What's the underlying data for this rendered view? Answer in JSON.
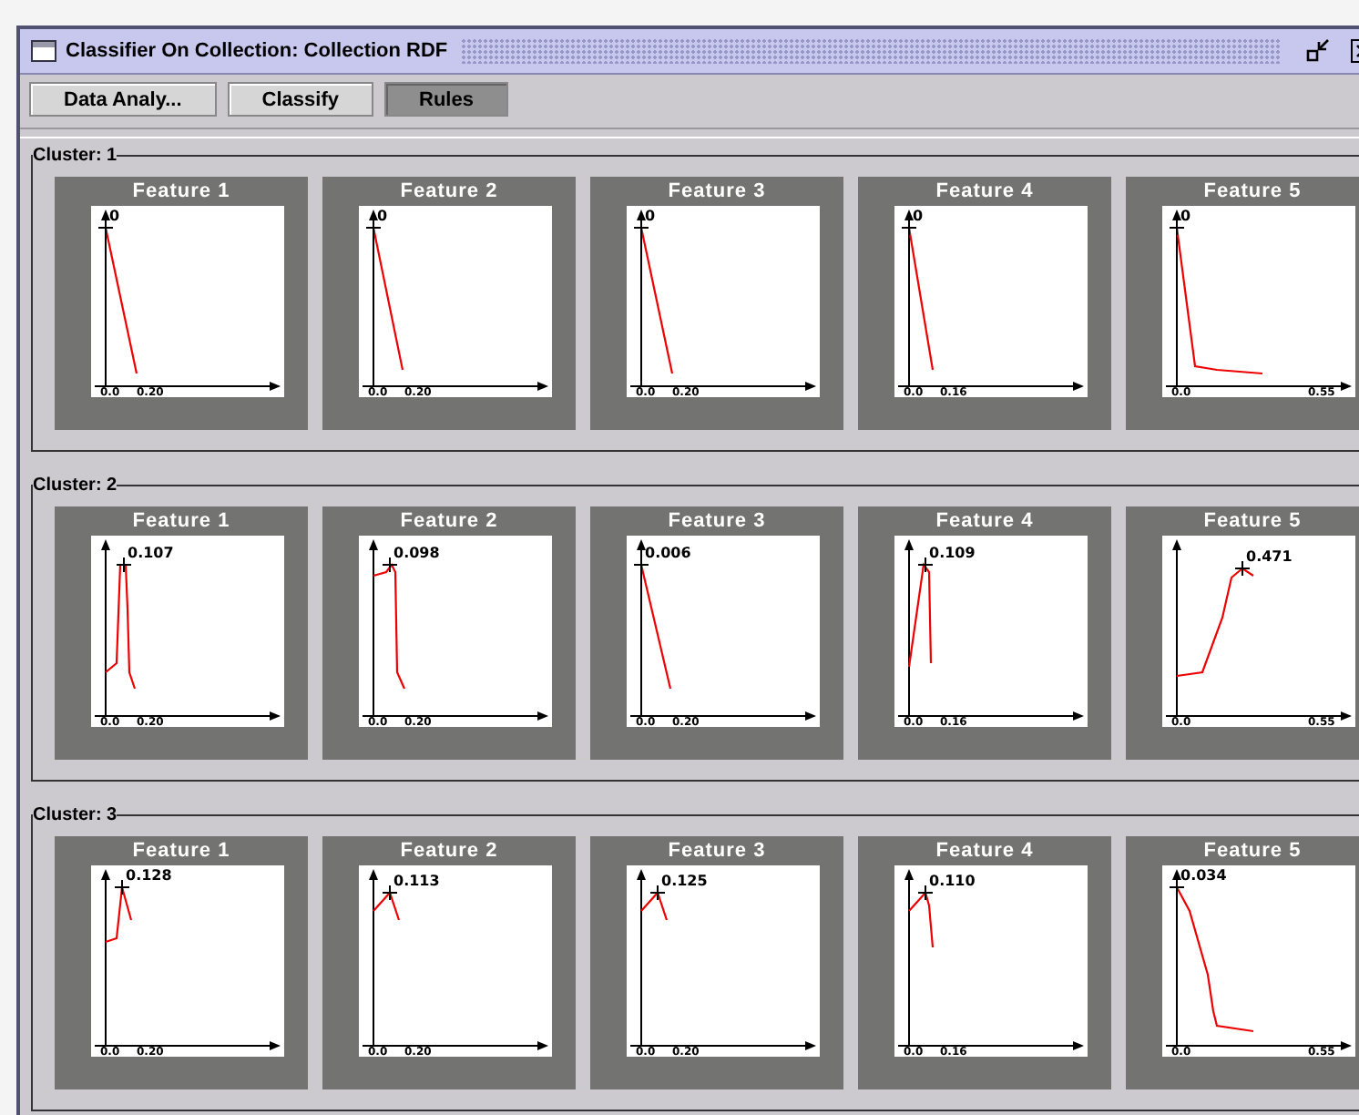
{
  "window": {
    "title": "Classifier On Collection:  Collection RDF"
  },
  "toolbar": [
    {
      "label": "Data Analy...",
      "selected": false
    },
    {
      "label": "Classify",
      "selected": false
    },
    {
      "label": "Rules",
      "selected": true
    }
  ],
  "clusters": [
    {
      "label": "Cluster: 1",
      "features": [
        {
          "title": "Feature 1",
          "peak_label": "0",
          "x_ticks": [
            "0.0",
            "0.20"
          ]
        },
        {
          "title": "Feature 2",
          "peak_label": "0",
          "x_ticks": [
            "0.0",
            "0.20"
          ]
        },
        {
          "title": "Feature 3",
          "peak_label": "0",
          "x_ticks": [
            "0.0",
            "0.20"
          ]
        },
        {
          "title": "Feature 4",
          "peak_label": "0",
          "x_ticks": [
            "0.0",
            "0.16"
          ]
        },
        {
          "title": "Feature 5",
          "peak_label": "0",
          "x_ticks": [
            "0.0",
            "0.55"
          ]
        }
      ]
    },
    {
      "label": "Cluster: 2",
      "features": [
        {
          "title": "Feature 1",
          "peak_label": "0.107",
          "x_ticks": [
            "0.0",
            "0.20"
          ]
        },
        {
          "title": "Feature 2",
          "peak_label": "0.098",
          "x_ticks": [
            "0.0",
            "0.20"
          ]
        },
        {
          "title": "Feature 3",
          "peak_label": "0.006",
          "x_ticks": [
            "0.0",
            "0.20"
          ]
        },
        {
          "title": "Feature 4",
          "peak_label": "0.109",
          "x_ticks": [
            "0.0",
            "0.16"
          ]
        },
        {
          "title": "Feature 5",
          "peak_label": "0.471",
          "x_ticks": [
            "0.0",
            "0.55"
          ]
        }
      ]
    },
    {
      "label": "Cluster: 3",
      "features": [
        {
          "title": "Feature 1",
          "peak_label": "0.128",
          "x_ticks": [
            "0.0",
            "0.20"
          ]
        },
        {
          "title": "Feature 2",
          "peak_label": "0.113",
          "x_ticks": [
            "0.0",
            "0.20"
          ]
        },
        {
          "title": "Feature 3",
          "peak_label": "0.125",
          "x_ticks": [
            "0.0",
            "0.20"
          ]
        },
        {
          "title": "Feature 4",
          "peak_label": "0.110",
          "x_ticks": [
            "0.0",
            "0.16"
          ]
        },
        {
          "title": "Feature 5",
          "peak_label": "0.034",
          "x_ticks": [
            "0.0",
            "0.55"
          ]
        }
      ]
    }
  ]
}
